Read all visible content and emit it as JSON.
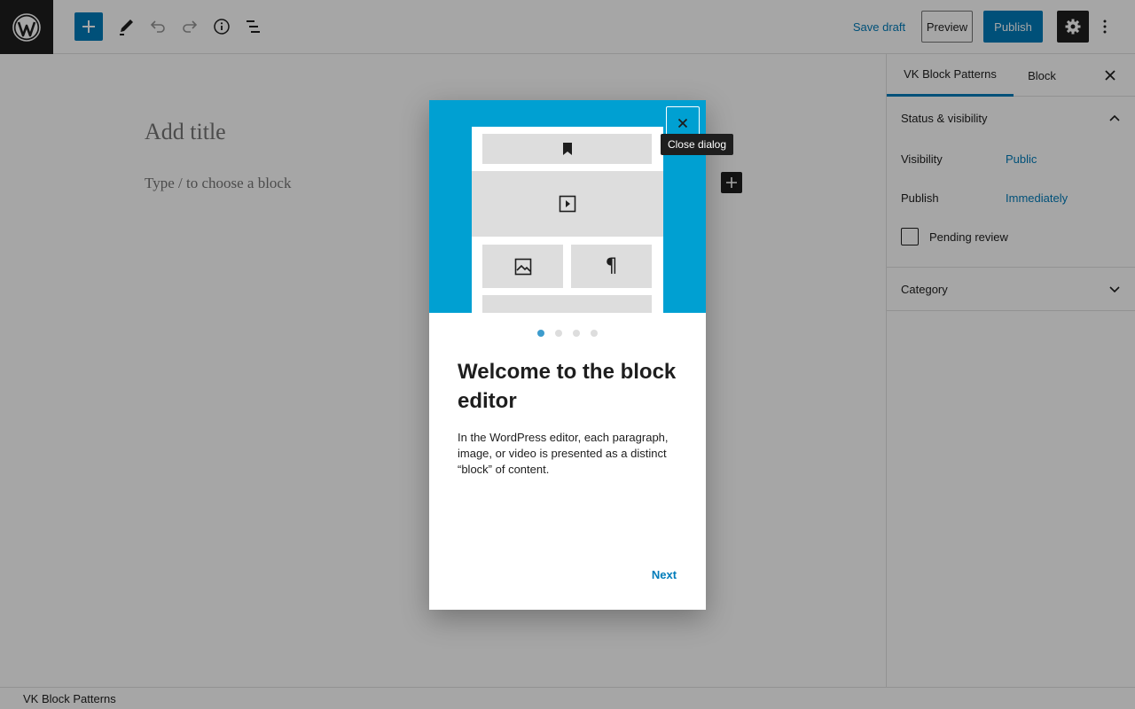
{
  "toolbar": {
    "save_draft": "Save draft",
    "preview": "Preview",
    "publish": "Publish"
  },
  "editor": {
    "title_placeholder": "Add title",
    "block_placeholder": "Type / to choose a block"
  },
  "sidebar": {
    "tabs": [
      {
        "label": "VK Block Patterns"
      },
      {
        "label": "Block"
      }
    ],
    "status_panel": {
      "title": "Status & visibility",
      "visibility_label": "Visibility",
      "visibility_value": "Public",
      "publish_label": "Publish",
      "publish_value": "Immediately",
      "pending_review_label": "Pending review"
    },
    "category_panel": {
      "title": "Category"
    }
  },
  "footer": {
    "breadcrumb": "VK Block Patterns"
  },
  "modal": {
    "close_tooltip": "Close dialog",
    "title": "Welcome to the block editor",
    "text": "In the WordPress editor, each paragraph, image, or video is presented as a distinct “block” of content.",
    "next": "Next",
    "page_count": 4,
    "current_page": 1
  },
  "colors": {
    "accent": "#007cba",
    "hero": "#00a0d2",
    "dark": "#1e1e1e"
  }
}
